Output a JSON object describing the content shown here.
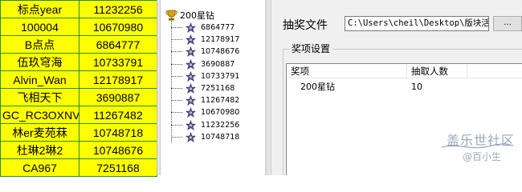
{
  "spreadsheet": {
    "rows": [
      [
        "标点year",
        "11232256"
      ],
      [
        "100004",
        "10670980"
      ],
      [
        "B点点",
        "6864777"
      ],
      [
        "伍玖穹海",
        "10733791"
      ],
      [
        "Alvin_Wan",
        "12178917"
      ],
      [
        "飞相天下",
        "3690887"
      ],
      [
        "GC_RC3OXNV",
        "11267482"
      ],
      [
        "林er麦苑菻",
        "10748718"
      ],
      [
        "杜琳2琳2",
        "10748676"
      ],
      [
        "CA967",
        "7251168"
      ]
    ]
  },
  "tree": {
    "root_label": "200星钻",
    "root_icon": "trophy-icon",
    "leaf_icon": "person-node-icon",
    "leaves": [
      "6864777",
      "12178917",
      "10748676",
      "3690887",
      "10733791",
      "7251168",
      "11267482",
      "10670980",
      "11232256",
      "10748718"
    ]
  },
  "dialog": {
    "file_label": "抽奖文件",
    "file_path": "C:\\Users\\cheil\\Desktop\\版块活",
    "browse_label": "...",
    "group_title": "奖项设置",
    "list": {
      "columns": [
        "奖项",
        "抽取人数"
      ],
      "rows": [
        [
          "200星钻",
          "10"
        ]
      ]
    }
  },
  "watermark": {
    "line1": "盖乐世社区",
    "line2": "@百小生"
  },
  "colors": {
    "cell_background": "#fdff00",
    "cell_border": "#2d8a2d",
    "dialog_background": "#f0f0f0",
    "watermark": "#9aa8b8"
  }
}
